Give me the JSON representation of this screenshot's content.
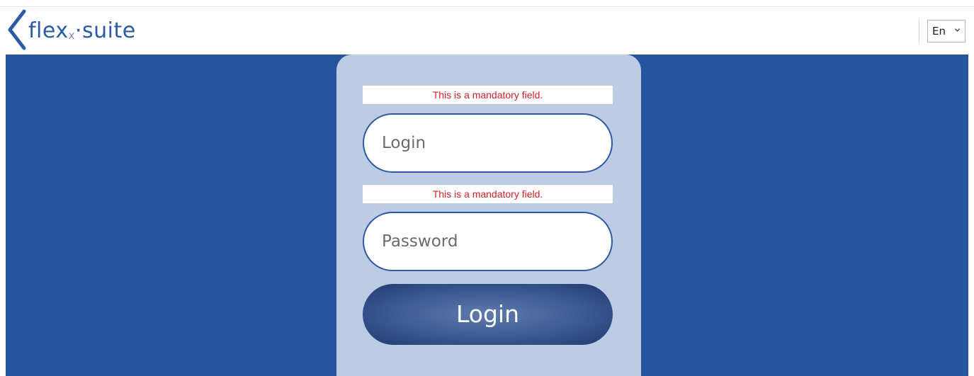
{
  "header": {
    "logo": {
      "brand_main": "flex",
      "brand_x": "x",
      "brand_dot": "·",
      "brand_suite": "suite"
    },
    "language": {
      "selected": "En"
    }
  },
  "login_form": {
    "login_error": "This is a mandatory field.",
    "login_placeholder": "Login",
    "login_value": "",
    "password_error": "This is a mandatory field.",
    "password_placeholder": "Password",
    "password_value": "",
    "submit_label": "Login"
  },
  "colors": {
    "brand_blue": "#2655a0",
    "card_bg": "#bccce4",
    "error_red": "#d32029",
    "logo_blue": "#2b5aa6"
  },
  "icons": {
    "logo_mark": "diamond-bracket-icon",
    "dropdown": "chevron-down-icon"
  }
}
